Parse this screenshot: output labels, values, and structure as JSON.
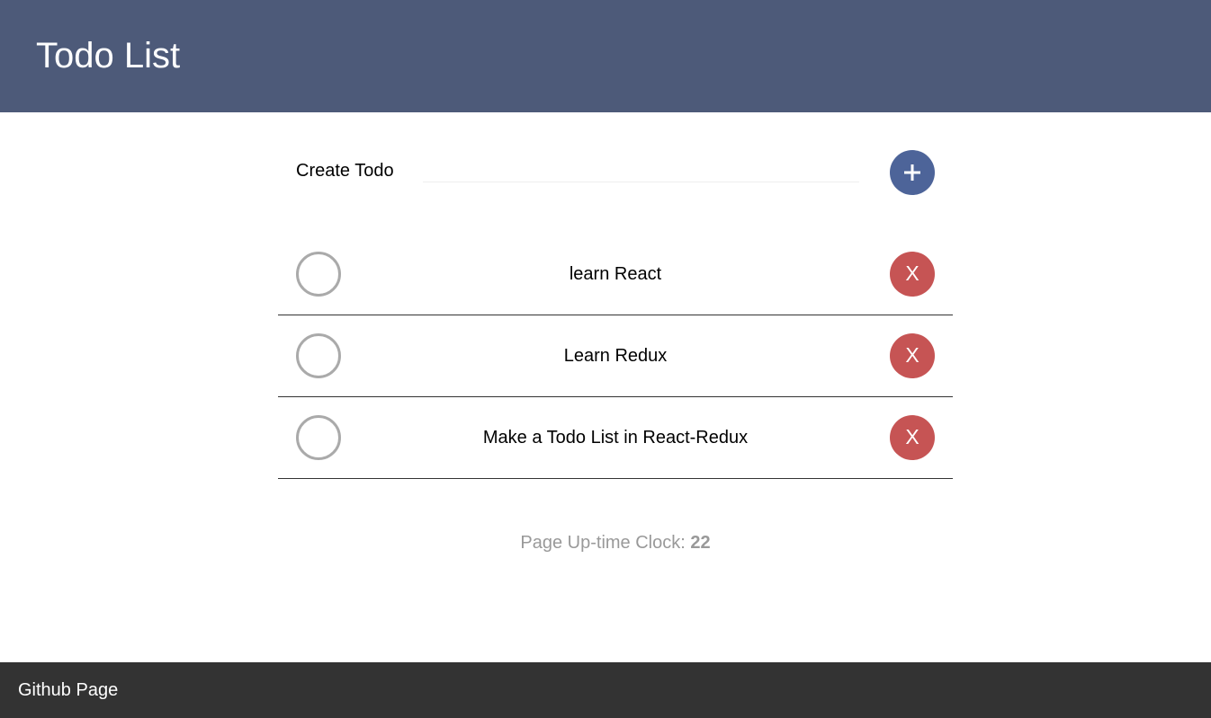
{
  "header": {
    "title": "Todo List"
  },
  "create": {
    "label": "Create Todo",
    "input_value": "",
    "placeholder": "",
    "add_icon": "plus-icon"
  },
  "todos": [
    {
      "text": "learn React",
      "completed": false,
      "delete_label": "X"
    },
    {
      "text": "Learn Redux",
      "completed": false,
      "delete_label": "X"
    },
    {
      "text": "Make a Todo List in React-Redux",
      "completed": false,
      "delete_label": "X"
    }
  ],
  "clock": {
    "label": "Page Up-time Clock: ",
    "value": "22"
  },
  "footer": {
    "link_text": "Github Page"
  },
  "colors": {
    "header_bg": "#4d5a79",
    "add_button": "#4d6499",
    "delete_button": "#c65454",
    "footer_bg": "#333333",
    "checkbox_border": "#aaaaaa",
    "clock_text": "#999999"
  }
}
